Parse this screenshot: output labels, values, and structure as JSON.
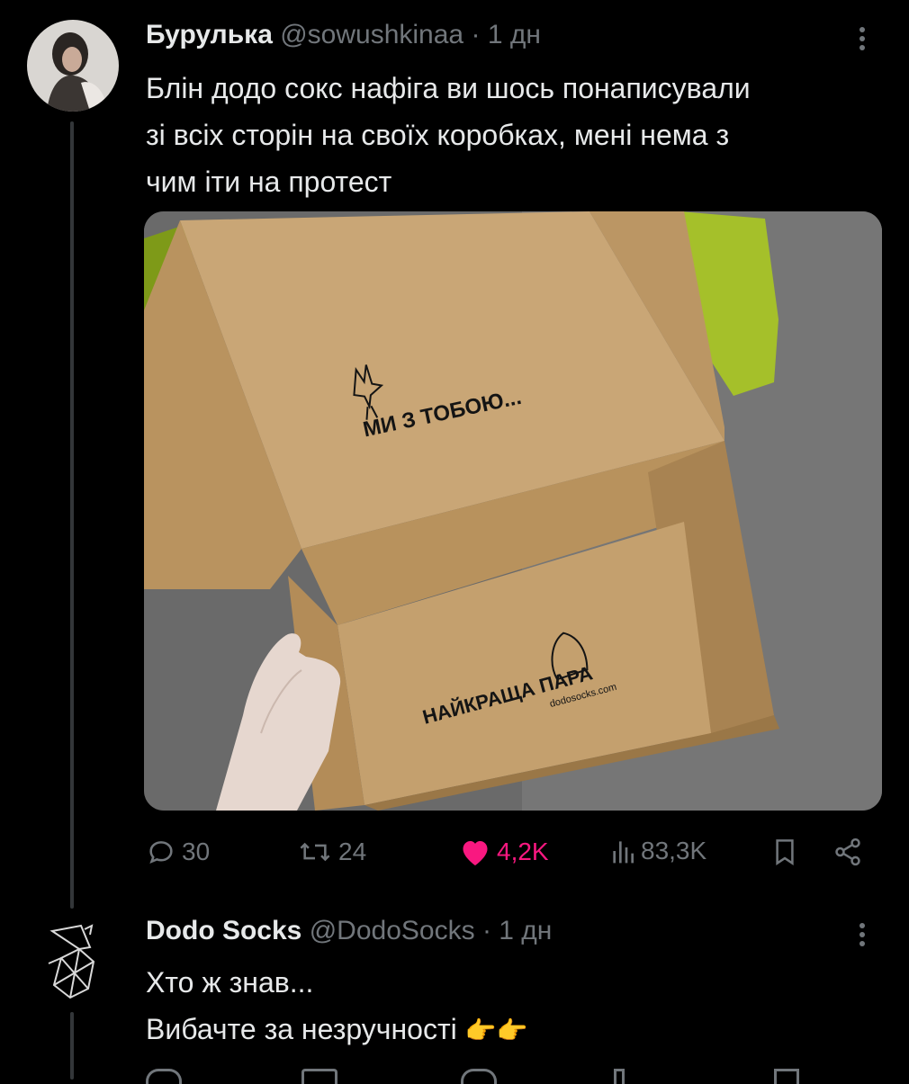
{
  "tweet": {
    "author_name": "Бурулька",
    "author_handle": "@sowushkinaa",
    "separator": "·",
    "time": "1 дн",
    "text_lines": [
      "Блін додо сокс нафіга ви шось понаписували",
      "зі всіх сторін на своїх коробках, мені нема з",
      "чим іти на протест"
    ],
    "media": {
      "lid_text": "МИ З ТОБОЮ...",
      "box_text": "НАЙКРАЩА ПАРА",
      "box_url": "dodosocks.com"
    },
    "actions": {
      "replies": "30",
      "retweets": "24",
      "likes": "4,2K",
      "views": "83,3K"
    },
    "colors": {
      "like": "#f91880",
      "muted": "#71767b",
      "text": "#e7e9ea"
    }
  },
  "reply": {
    "author_name": "Dodo Socks",
    "author_handle": "@DodoSocks",
    "separator": "·",
    "time": "1 дн",
    "text_lines": [
      "Хто ж знав...",
      "Вибачте за незручності"
    ],
    "emoji": "👉👉"
  }
}
